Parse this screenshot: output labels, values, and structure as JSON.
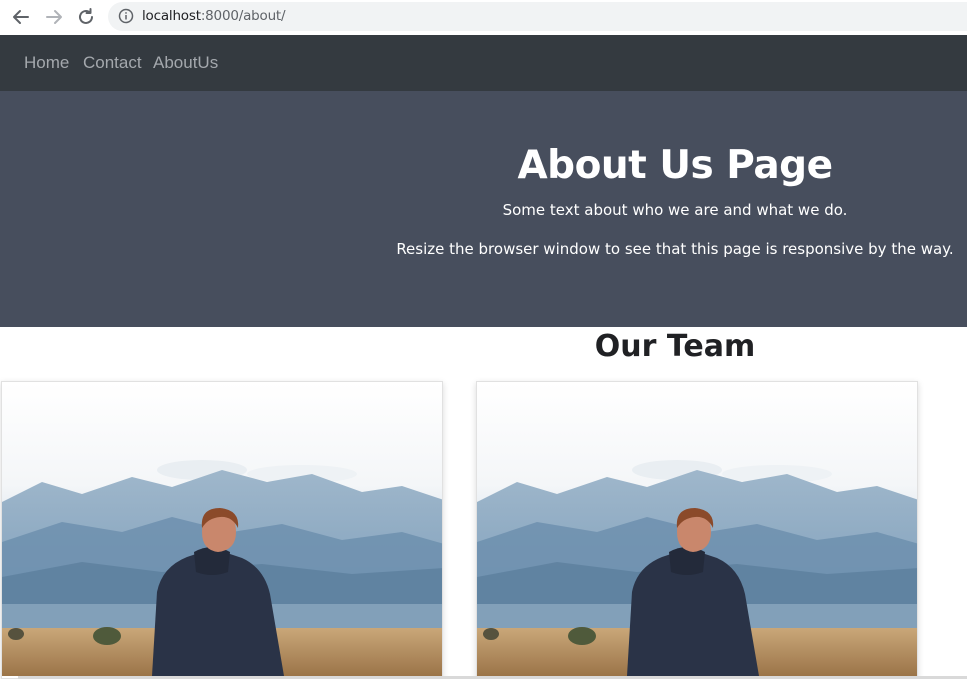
{
  "browser": {
    "url_host": "localhost",
    "url_path": ":8000/about/",
    "icons": [
      "back-arrow-icon",
      "forward-arrow-icon",
      "reload-icon",
      "info-icon"
    ]
  },
  "navbar": {
    "links": [
      {
        "label": "Home"
      },
      {
        "label": "Contact"
      },
      {
        "label": "AboutUs"
      }
    ]
  },
  "hero": {
    "title": "About Us Page",
    "text1": "Some text about who we are and what we do.",
    "text2": "Resize the browser window to see that this page is responsive by the way."
  },
  "team": {
    "heading": "Our Team"
  },
  "colors": {
    "navbar_bg": "#343a40",
    "hero_bg": "#474e5d",
    "nav_link": "#a4a8ad"
  }
}
